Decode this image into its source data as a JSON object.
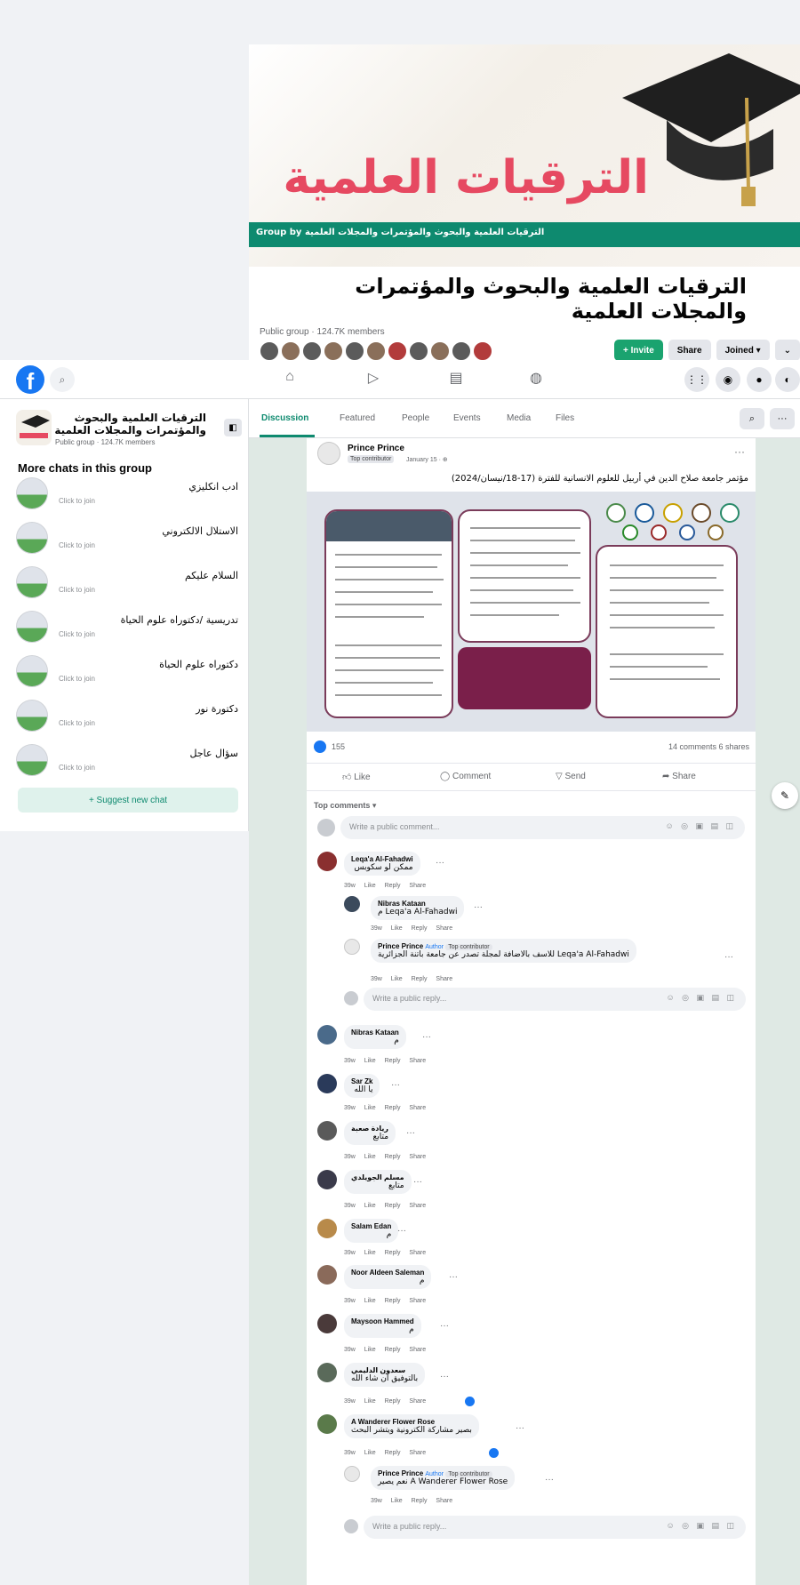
{
  "header": {
    "cover_title": "الترقيات العلمية",
    "cover_strip": "Group by الترقيات العلمية والبحوث والمؤتمرات والمجلات العلمية",
    "group_name": "الترقيات العلمية والبحوث والمؤتمرات والمجلات العلمية",
    "group_meta": "Public group · 124.7K members",
    "actions": {
      "invite": "+ Invite",
      "share": "Share",
      "joined": "Joined ▾",
      "more": "⌄"
    }
  },
  "nav": {
    "logo": "f",
    "search_icon": "⌕",
    "icons": [
      "home-icon",
      "video-icon",
      "marketplace-icon",
      "gaming-icon"
    ],
    "right_icons": [
      "menu-icon",
      "messenger-icon",
      "bell-icon",
      "avatar-icon"
    ]
  },
  "sidebar": {
    "group_title": "الترقيات العلمية والبحوث والمؤتمرات والمجلات العلمية",
    "group_meta": "Public group · 124.7K members",
    "heading": "More chats in this group",
    "chats": [
      {
        "name": "ادب انكليزي",
        "sub": "Click to join"
      },
      {
        "name": "الاستلال الالكتروني",
        "sub": "Click to join"
      },
      {
        "name": "السلام عليكم",
        "sub": "Click to join"
      },
      {
        "name": "تدريسية /دكتوراه علوم الحياة",
        "sub": "Click to join"
      },
      {
        "name": "دكتوراه علوم الحياة",
        "sub": "Click to join"
      },
      {
        "name": "دكتورة نور",
        "sub": "Click to join"
      },
      {
        "name": "سؤال عاجل",
        "sub": "Click to join"
      }
    ],
    "suggest": "+ Suggest new chat"
  },
  "tabs": [
    "Discussion",
    "Featured",
    "People",
    "Events",
    "Media",
    "Files"
  ],
  "post": {
    "author": "Prince Prince",
    "badge": "Top contributor",
    "date": "January 15 · ⊕",
    "text": "مؤتمر جامعة صلاح الدين في أربيل للعلوم الانسانية للفترة (17-18/نيسان/2024)",
    "like_count": "155",
    "comments_shares": "14 comments  6 shares",
    "actions": {
      "like": "Like",
      "comment": "Comment",
      "send": "Send",
      "share": "Share"
    },
    "sort_label": "Top comments ▾",
    "write_comment": "Write a public comment...",
    "write_reply": "Write a public reply...",
    "comment_tools": "☺ ◎ ▣ ▤ ◫"
  },
  "comments": [
    {
      "name": "Leqa'a Al-Fahadwi",
      "text": "ممكن لو سكوبس",
      "meta": "39w Like Reply Share"
    },
    {
      "name": "Nibras Kataan",
      "text": "Leqa'a Al-Fahadwi م",
      "meta": "39w Like Reply Share"
    },
    {
      "name": "Prince Prince",
      "tag": "Author",
      "badge": "Top contributor",
      "text": "Leqa'a Al-Fahadwi للاسف بالاضافة لمجلة تصدر عن جامعة باتنة الجزائرية",
      "meta": "39w Like Reply Share"
    },
    {
      "name": "Nibras Kataan",
      "text": "م",
      "meta": "39w Like Reply Share"
    },
    {
      "name": "Sar Zk",
      "text": "يا الله",
      "meta": "39w Like Reply Share"
    },
    {
      "name": "ريادة صعبة",
      "text": "متابع",
      "meta": "39w Like Reply Share"
    },
    {
      "name": "مسلم الجويلدي",
      "text": "متابع",
      "meta": "39w Like Reply Share"
    },
    {
      "name": "Salam Edan",
      "text": "م",
      "meta": "39w Like Reply Share"
    },
    {
      "name": "Noor Aldeen Saleman",
      "text": "م",
      "meta": "39w Like Reply Share"
    },
    {
      "name": "Maysoon Hammed",
      "text": "م",
      "meta": "39w Like Reply Share"
    },
    {
      "name": "سعدون الدليمي",
      "text": "بالتوفيق ان شاء الله",
      "meta": "39w Like Reply Share"
    },
    {
      "name": "A Wanderer Flower Rose",
      "text": "بصير مشاركة الكترونية ويتشر البحث",
      "meta": "39w Like Reply Share"
    },
    {
      "name": "Prince Prince",
      "tag": "Author",
      "badge": "Top contributor",
      "text": "A Wanderer Flower Rose نعم يصير",
      "meta": "39w Like Reply Share"
    }
  ]
}
